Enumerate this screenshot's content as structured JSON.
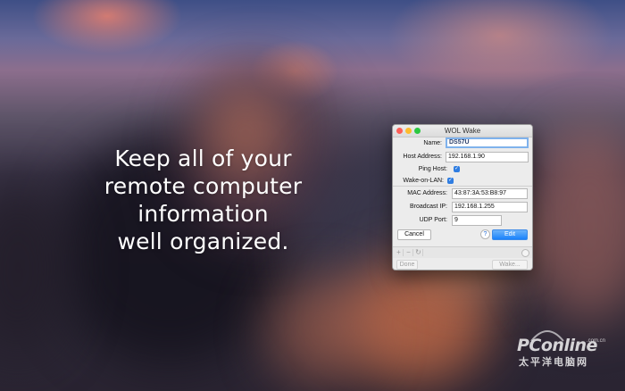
{
  "headline": {
    "line1": "Keep all of your",
    "line2": "remote computer",
    "line3": "information",
    "line4": "well organized."
  },
  "window": {
    "title": "WOL Wake",
    "fields": {
      "name": {
        "label": "Name:",
        "value": "DS57U"
      },
      "host": {
        "label": "Host Address:",
        "value": "192.168.1.90"
      },
      "ping": {
        "label": "Ping Host:",
        "checked": true
      },
      "wol": {
        "label": "Wake-on-LAN:",
        "checked": true
      },
      "mac": {
        "label": "MAC Address:",
        "value": "43:87:3A:53:B8:97"
      },
      "broadcast": {
        "label": "Broadcast IP:",
        "value": "192.168.1.255"
      },
      "udp": {
        "label": "UDP Port:",
        "value": "9"
      }
    },
    "buttons": {
      "cancel": "Cancel",
      "help": "?",
      "edit": "Edit",
      "add": "+",
      "remove": "−",
      "refresh": "↻",
      "done": "Done",
      "wake": "Wake..."
    }
  },
  "watermark": {
    "main": "PConline",
    "domain": ".com.cn",
    "sub": "太平洋电脑网"
  },
  "colors": {
    "accent": "#1a82fb",
    "checkbox": "#2f7de1",
    "close": "#fd5e57",
    "minimize": "#fdbc2e",
    "maximize": "#2bc841"
  }
}
